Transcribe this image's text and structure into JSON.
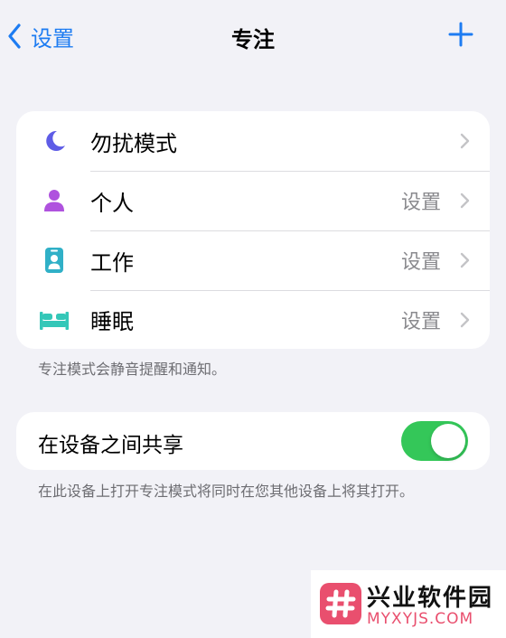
{
  "nav": {
    "back_label": "设置",
    "title": "专注",
    "add_icon": "plus-icon",
    "accent_color": "#1d7cf2"
  },
  "focus_modes": [
    {
      "label": "勿扰模式",
      "detail": "",
      "icon": "moon-icon",
      "icon_color": "#5e5ce6"
    },
    {
      "label": "个人",
      "detail": "设置",
      "icon": "person-icon",
      "icon_color": "#af52de"
    },
    {
      "label": "工作",
      "detail": "设置",
      "icon": "id-badge-icon",
      "icon_color": "#30b0c7"
    },
    {
      "label": "睡眠",
      "detail": "设置",
      "icon": "bed-icon",
      "icon_color": "#34c7b8"
    }
  ],
  "focus_footnote": "专注模式会静音提醒和通知。",
  "share": {
    "label": "在设备之间共享",
    "enabled": true,
    "toggle_color": "#34c759",
    "footnote": "在此设备上打开专注模式将同时在您其他设备上将其打开。"
  },
  "watermark": {
    "name": "兴业软件园",
    "url": "MYXYJS.COM"
  }
}
